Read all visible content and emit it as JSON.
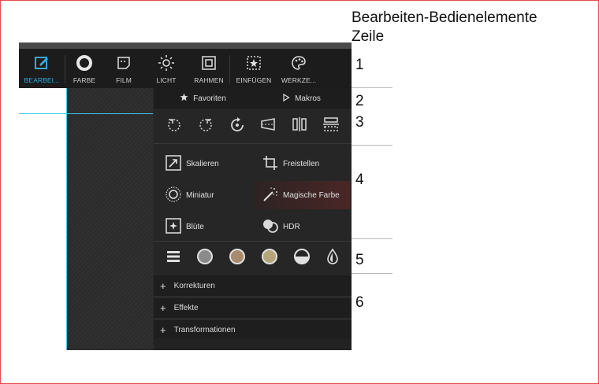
{
  "annotations": {
    "title": "Bearbeiten-Bedienelemente",
    "row_header": "Zeile",
    "rows": [
      "1",
      "2",
      "3",
      "4",
      "5",
      "6"
    ]
  },
  "toolbar": {
    "items": [
      {
        "label": "BEARBEI...",
        "icon": "edit-icon",
        "active": true
      },
      {
        "label": "FARBE",
        "icon": "color-ring-icon"
      },
      {
        "label": "FILM",
        "icon": "film-icon"
      },
      {
        "label": "LICHT",
        "icon": "sun-icon"
      },
      {
        "label": "RAHMEN",
        "icon": "frame-icon"
      },
      {
        "label": "EINFÜGEN",
        "icon": "insert-star-icon"
      },
      {
        "label": "WERKZE...",
        "icon": "palette-icon"
      }
    ]
  },
  "panel": {
    "favorites_label": "Favoriten",
    "macros_label": "Makros",
    "quick_tools": [
      "rotate-left-icon",
      "rotate-right-icon",
      "rotate-free-icon",
      "perspective-icon",
      "flip-horizontal-icon",
      "flip-vertical-icon"
    ],
    "big_tools": [
      {
        "label": "Skalieren",
        "icon": "resize-icon"
      },
      {
        "label": "Freistellen",
        "icon": "crop-icon"
      },
      {
        "label": "Miniatur",
        "icon": "miniature-icon"
      },
      {
        "label": "Magische Farbe",
        "icon": "magic-wand-icon",
        "highlighted": true
      },
      {
        "label": "Blüte",
        "icon": "bloom-icon"
      },
      {
        "label": "HDR",
        "icon": "hdr-icon"
      }
    ],
    "circle_tools": [
      "list-icon",
      "gray-circle-icon",
      "tan-circle-icon",
      "gold-circle-icon",
      "half-circle-icon",
      "drop-icon"
    ],
    "sections": [
      "Korrekturen",
      "Effekte",
      "Transformationen"
    ]
  },
  "colors": {
    "accent": "#35a8e0",
    "guide": "#3ec8e8",
    "frame": "#e84a4a"
  }
}
